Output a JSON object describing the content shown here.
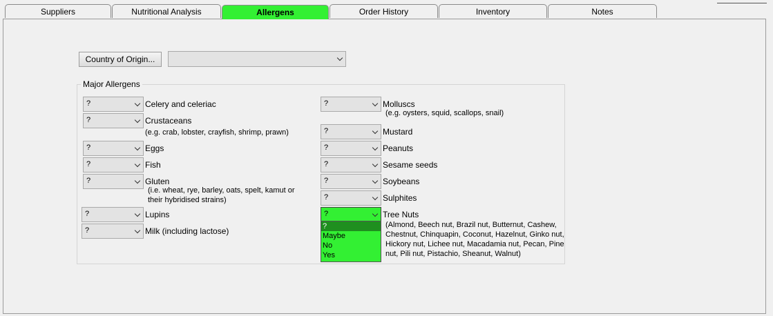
{
  "tabs": [
    "Suppliers",
    "Nutritional Analysis",
    "Allergens",
    "Order History",
    "Inventory",
    "Notes"
  ],
  "corner_mark": "0",
  "country": {
    "button_label": "Country of Origin...",
    "value": ""
  },
  "group_title": "Major Allergens",
  "allergens": {
    "celery": {
      "value": "?",
      "label": "Celery and celeriac"
    },
    "crustaceans": {
      "value": "?",
      "label": "Crustaceans",
      "note": "(e.g. crab, lobster, crayfish, shrimp, prawn)"
    },
    "eggs": {
      "value": "?",
      "label": "Eggs"
    },
    "fish": {
      "value": "?",
      "label": "Fish"
    },
    "gluten": {
      "value": "?",
      "label": "Gluten",
      "note1": "(i.e. wheat, rye, barley, oats, spelt, kamut or",
      "note2": "their hybridised strains)"
    },
    "lupins": {
      "value": "?",
      "label": "Lupins"
    },
    "milk": {
      "value": "?",
      "label": "Milk (including lactose)"
    },
    "molluscs": {
      "value": "?",
      "label": "Molluscs",
      "note": "(e.g. oysters, squid, scallops, snail)"
    },
    "mustard": {
      "value": "?",
      "label": "Mustard"
    },
    "peanuts": {
      "value": "?",
      "label": "Peanuts"
    },
    "sesame": {
      "value": "?",
      "label": "Sesame seeds"
    },
    "soybeans": {
      "value": "?",
      "label": "Soybeans"
    },
    "sulphites": {
      "value": "?",
      "label": "Sulphites"
    },
    "tree_nuts": {
      "value": "?",
      "label": "Tree Nuts",
      "note1": "(Almond, Beech nut, Brazil nut, Butternut, Cashew,",
      "note2": "Chestnut, Chinquapin, Coconut, Hazelnut, Ginko nut,",
      "note3": "Hickory nut, Lichee nut, Macadamia nut, Pecan, Pine",
      "note4": "nut, Pili nut, Pistachio, Sheanut, Walnut)"
    }
  },
  "dropdown_options": [
    "?",
    "Maybe",
    "No",
    "Yes"
  ],
  "colors": {
    "active_tab": "#33f033",
    "selected_option": "#1f8f1f"
  }
}
